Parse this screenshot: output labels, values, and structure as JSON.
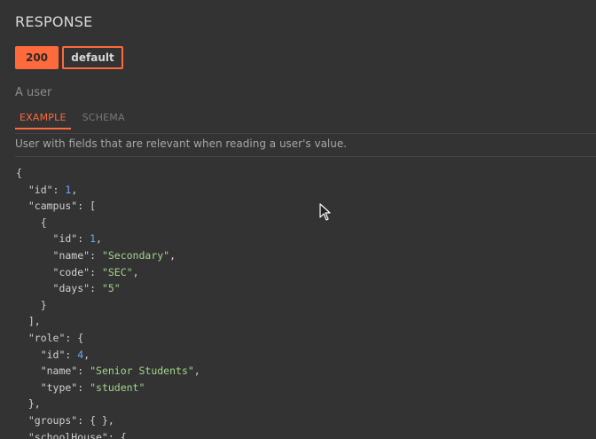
{
  "header": {
    "title": "RESPONSE"
  },
  "status_codes": {
    "active": "200",
    "other": "default"
  },
  "response": {
    "description": "A user"
  },
  "tabs": {
    "example": "EXAMPLE",
    "schema": "SCHEMA"
  },
  "schema_description": "User with fields that are relevant when reading a user's value.",
  "code_lines": [
    [
      [
        "k",
        "{"
      ]
    ],
    [
      [
        "k",
        "  \"id\": "
      ],
      [
        "n",
        "1"
      ],
      [
        "k",
        ","
      ]
    ],
    [
      [
        "k",
        "  \"campus\": ["
      ]
    ],
    [
      [
        "k",
        "    {"
      ]
    ],
    [
      [
        "k",
        "      \"id\": "
      ],
      [
        "n",
        "1"
      ],
      [
        "k",
        ","
      ]
    ],
    [
      [
        "k",
        "      \"name\": "
      ],
      [
        "s",
        "\"Secondary\""
      ],
      [
        "k",
        ","
      ]
    ],
    [
      [
        "k",
        "      \"code\": "
      ],
      [
        "s",
        "\"SEC\""
      ],
      [
        "k",
        ","
      ]
    ],
    [
      [
        "k",
        "      \"days\": "
      ],
      [
        "s",
        "\"5\""
      ]
    ],
    [
      [
        "k",
        "    }"
      ]
    ],
    [
      [
        "k",
        "  ],"
      ]
    ],
    [
      [
        "k",
        "  \"role\": {"
      ]
    ],
    [
      [
        "k",
        "    \"id\": "
      ],
      [
        "n",
        "4"
      ],
      [
        "k",
        ","
      ]
    ],
    [
      [
        "k",
        "    \"name\": "
      ],
      [
        "s",
        "\"Senior Students\""
      ],
      [
        "k",
        ","
      ]
    ],
    [
      [
        "k",
        "    \"type\": "
      ],
      [
        "s",
        "\"student\""
      ]
    ],
    [
      [
        "k",
        "  },"
      ]
    ],
    [
      [
        "k",
        "  \"groups\": { },"
      ]
    ],
    [
      [
        "k",
        "  \"schoolHouse\": {"
      ]
    ]
  ],
  "colors": {
    "accent": "#ff6a3d",
    "background": "#333333",
    "number": "#6ea8ff",
    "string": "#a3d48c"
  }
}
